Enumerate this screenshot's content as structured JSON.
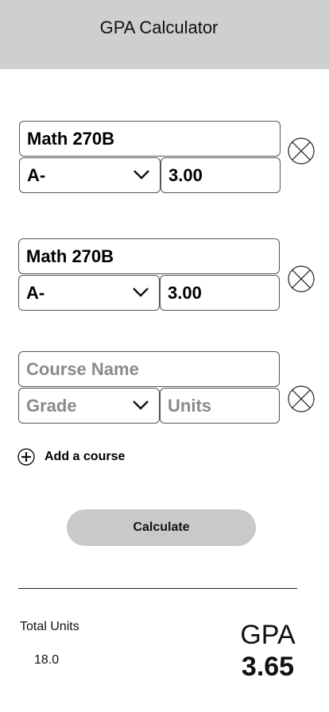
{
  "header": {
    "title": "GPA Calculator"
  },
  "courses": [
    {
      "name": "Math 270B",
      "grade": "A-",
      "units": "3.00"
    },
    {
      "name": "Math 270B",
      "grade": "A-",
      "units": "3.00"
    },
    {
      "name_placeholder": "Course Name",
      "grade_placeholder": "Grade",
      "units_placeholder": "Units"
    }
  ],
  "add_course": {
    "label": "Add a course"
  },
  "calculate": {
    "label": "Calculate"
  },
  "summary": {
    "total_units_label": "Total Units",
    "total_units_value": "18.0",
    "gpa_label": "GPA",
    "gpa_value": "3.65"
  },
  "colors": {
    "header_bg": "#cfcfcf",
    "button_bg": "#c9c9c9",
    "border": "#555555",
    "placeholder_text": "#8a8a8a"
  },
  "icons": {
    "dropdown": "chevron-down-icon",
    "remove": "circle-x-icon",
    "add": "circle-plus-icon"
  }
}
